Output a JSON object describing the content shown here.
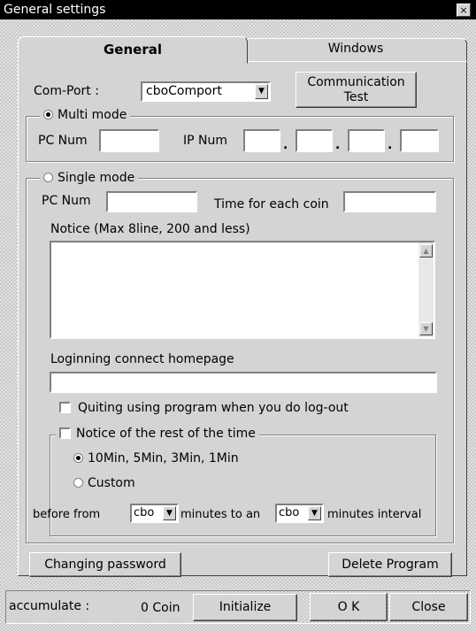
{
  "window": {
    "title": "General settings",
    "close_glyph": "×"
  },
  "tabs": [
    {
      "label": "General",
      "active": true
    },
    {
      "label": "Windows",
      "active": false
    }
  ],
  "comport": {
    "label": "Com-Port :",
    "value": "cboComport"
  },
  "comm_test": {
    "line1": "Communication",
    "line2": "Test"
  },
  "multi_mode": {
    "label": "Multi mode",
    "selected": true,
    "pc_num_label": "PC Num",
    "pc_num_value": "",
    "ip_num_label": "IP Num",
    "ip_separator": "."
  },
  "single_mode": {
    "label": "Single mode",
    "selected": false,
    "pc_num_label": "PC Num",
    "pc_num_value": "",
    "time_label": "Time for each coin",
    "time_value": "",
    "notice_label": "Notice (Max 8line, 200 and less)",
    "notice_value": "",
    "homepage_label": "Loginning connect homepage",
    "homepage_value": "",
    "quit_checkbox_label": "Quiting using program when you do log-out",
    "rest_time": {
      "label": "Notice of the rest of the time",
      "option1": "10Min, 5Min, 3Min, 1Min",
      "option2": "Custom",
      "before_from": "before from",
      "combo_from": "cbo",
      "minutes_to_an": "minutes to an",
      "combo_to": "cbo",
      "minutes_interval": "minutes interval"
    }
  },
  "buttons": {
    "change_password": "Changing password",
    "delete_program": "Delete Program",
    "initialize": "Initialize",
    "ok": "O K",
    "close": "Close"
  },
  "status": {
    "accumulate_label": "accumulate :",
    "coin_value": "0 Coin"
  },
  "icons": {
    "dropdown": "▼",
    "scroll_up": "▲",
    "scroll_down": "▼"
  }
}
